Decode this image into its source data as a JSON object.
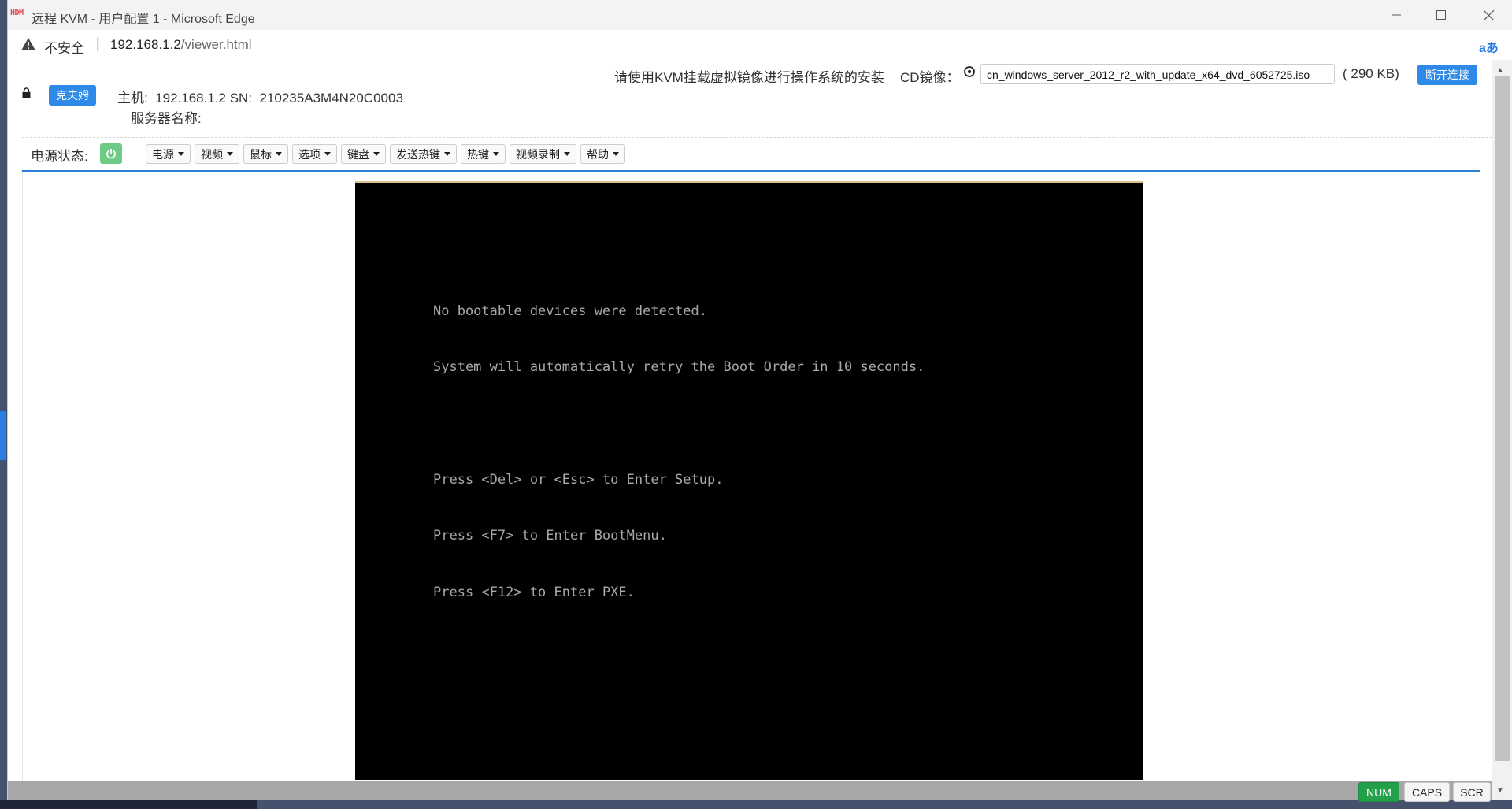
{
  "browser": {
    "app_logo": "HDM",
    "window_title": "远程 KVM - 用户配置 1 - Microsoft Edge",
    "security_label": "不安全",
    "url_host": "192.168.1.2",
    "url_path": "/viewer.html",
    "translate_icon": "aあ",
    "icons": [
      "warning-icon",
      "minimize-icon",
      "maximize-icon",
      "close-icon",
      "translate-icon"
    ]
  },
  "header": {
    "kfm_button": "克夫姆",
    "host_line": "主机:  192.168.1.2 SN:  210235A3M4N20C0003",
    "server_name_line": "服务器名称:",
    "notice": "请使用KVM挂载虚拟镜像进行操作系统的安装",
    "cd_label": "CD镜像：",
    "iso_file": "cn_windows_server_2012_r2_with_update_x64_dvd_6052725.iso",
    "iso_size": "( 290 KB)",
    "disconnect_button": "断开连接"
  },
  "toolbar": {
    "power_label": "电源状态:",
    "power_state_color": "#6ccc86",
    "menus": [
      "电源",
      "视频",
      "鼠标",
      "选项",
      "键盘",
      "发送热键",
      "热键",
      "视频录制",
      "帮助"
    ]
  },
  "console": {
    "lines": [
      "No bootable devices were detected.",
      "System will automatically retry the Boot Order in 10 seconds.",
      "",
      "Press <Del> or <Esc> to Enter Setup.",
      "Press <F7> to Enter BootMenu.",
      "Press <F12> to Enter PXE."
    ]
  },
  "statusbar": {
    "num": "NUM",
    "caps": "CAPS",
    "scr": "SCR",
    "num_active_color": "#23a04a"
  }
}
